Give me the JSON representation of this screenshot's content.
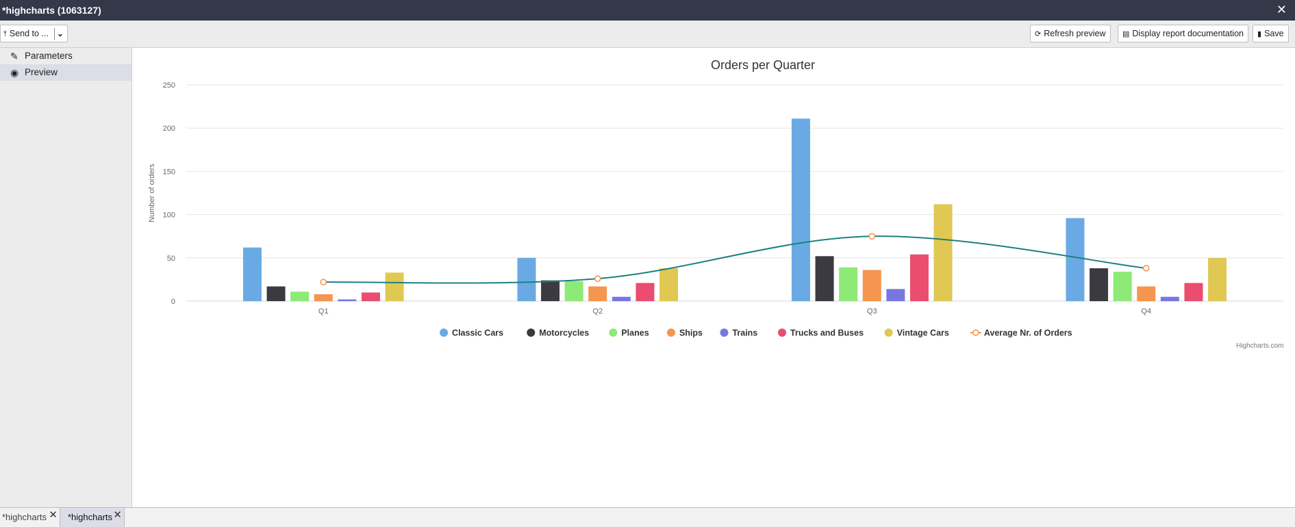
{
  "window": {
    "title": "*highcharts (1063127)",
    "close_icon": "close-icon"
  },
  "toolbar": {
    "send_to_label": "Send to ...",
    "refresh_label": "Refresh preview",
    "docs_label": "Display report documentation",
    "save_label": "Save"
  },
  "sidebar": {
    "items": [
      {
        "label": "Parameters",
        "icon": "edit-icon"
      },
      {
        "label": "Preview",
        "icon": "eye-icon"
      }
    ]
  },
  "chart_data": {
    "type": "bar",
    "title": "Orders per Quarter",
    "ylabel": "Number of orders",
    "xlabel": "",
    "ylim": [
      0,
      250
    ],
    "yticks": [
      0,
      50,
      100,
      150,
      200,
      250
    ],
    "categories": [
      "Q1",
      "Q2",
      "Q3",
      "Q4"
    ],
    "grid": true,
    "legend_position": "bottom-center",
    "series": [
      {
        "name": "Classic Cars",
        "color": "#6aaae4",
        "values": [
          62,
          50,
          211,
          96
        ]
      },
      {
        "name": "Motorcycles",
        "color": "#3a3a40",
        "values": [
          17,
          24,
          52,
          38
        ]
      },
      {
        "name": "Planes",
        "color": "#8eea76",
        "values": [
          11,
          23,
          39,
          34
        ]
      },
      {
        "name": "Ships",
        "color": "#f4964f",
        "values": [
          8,
          17,
          36,
          17
        ]
      },
      {
        "name": "Trains",
        "color": "#7877e2",
        "values": [
          2,
          5,
          14,
          5
        ]
      },
      {
        "name": "Trucks and Buses",
        "color": "#ea4d6f",
        "values": [
          10,
          21,
          54,
          21
        ]
      },
      {
        "name": "Vintage Cars",
        "color": "#e0c853",
        "values": [
          33,
          38,
          112,
          50
        ]
      }
    ],
    "line_series": {
      "name": "Average Nr. of Orders",
      "type": "spline",
      "color": "#1e7f7f",
      "marker_color": "#f4964f",
      "values": [
        22,
        26,
        75,
        38
      ]
    },
    "credits": "Highcharts.com"
  },
  "tabs": [
    {
      "label": "*highcharts"
    },
    {
      "label": "*highcharts"
    }
  ]
}
